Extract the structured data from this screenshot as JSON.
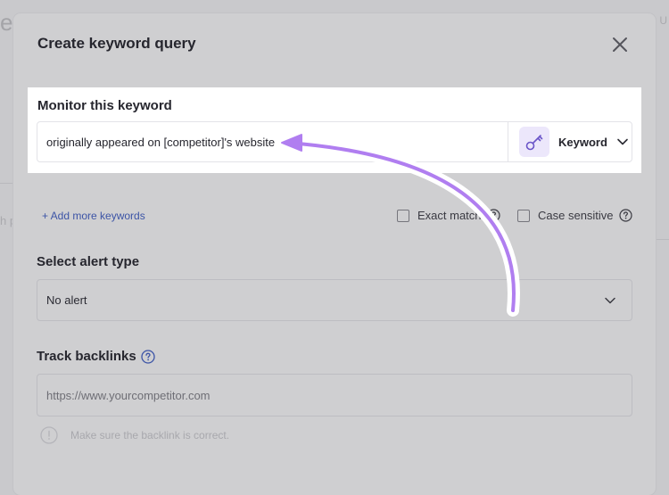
{
  "background": {
    "title_fragment": "e",
    "side_fragment": "h p",
    "right_fragment": "t U"
  },
  "modal": {
    "title": "Create keyword query"
  },
  "keyword": {
    "label": "Monitor this keyword",
    "value": "originally appeared on [competitor]'s website",
    "type_label": "Keyword",
    "type_icon": "key-icon"
  },
  "options": {
    "add_more": "+ Add more keywords",
    "exact_match": "Exact match",
    "case_sensitive": "Case sensitive"
  },
  "alert": {
    "label": "Select alert type",
    "selected": "No alert"
  },
  "backlinks": {
    "label": "Track backlinks",
    "placeholder": "https://www.yourcompetitor.com",
    "hint": "Make sure the backlink is correct."
  },
  "colors": {
    "accent": "#3c54a6",
    "arrow": "#b07ef0",
    "key_bg": "#ece7fb",
    "key_icon": "#6a55c8"
  }
}
